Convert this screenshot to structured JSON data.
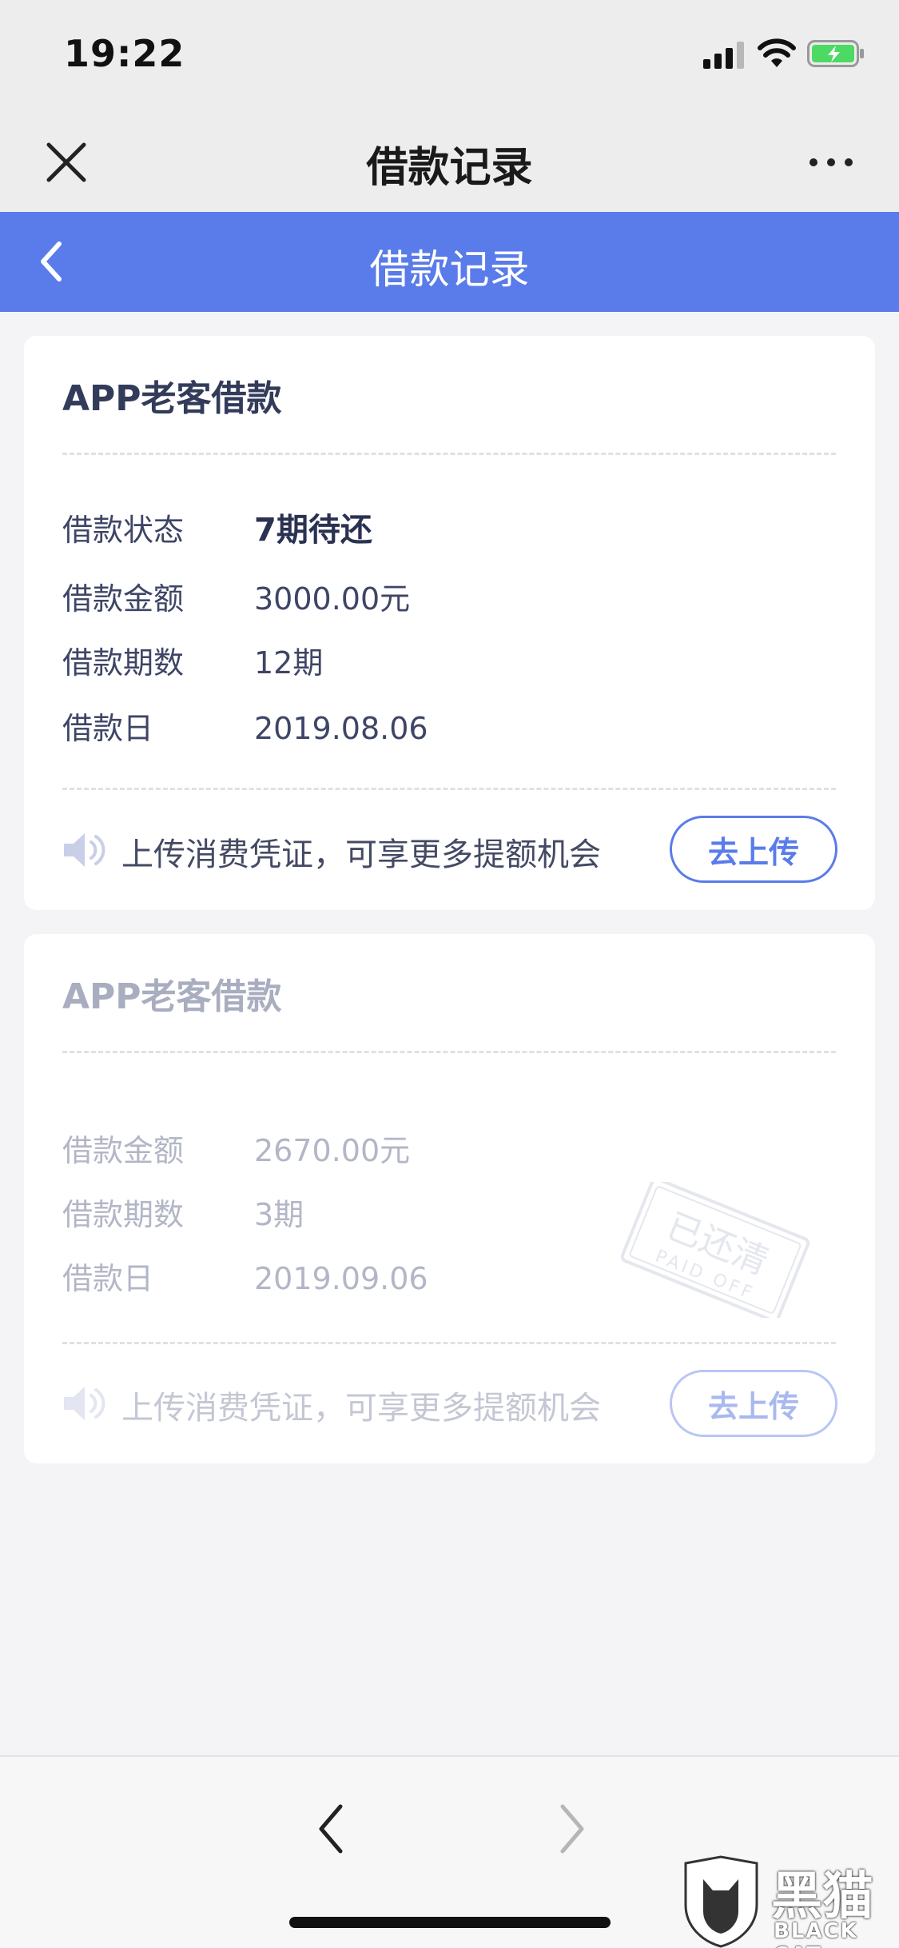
{
  "status": {
    "time": "19:22"
  },
  "webview": {
    "title": "借款记录"
  },
  "app": {
    "title": "借款记录"
  },
  "records": [
    {
      "title": "APP老客借款",
      "rows": [
        {
          "label": "借款状态",
          "value": "7期待还"
        },
        {
          "label": "借款金额",
          "value": "3000.00元"
        },
        {
          "label": "借款期数",
          "value": "12期"
        },
        {
          "label": "借款日",
          "value": "2019.08.06"
        }
      ],
      "notice": "上传消费凭证，可享更多提额机会",
      "button": "去上传"
    },
    {
      "title": "APP老客借款",
      "rows": [
        {
          "label": "借款金额",
          "value": "2670.00元"
        },
        {
          "label": "借款期数",
          "value": "3期"
        },
        {
          "label": "借款日",
          "value": "2019.09.06"
        }
      ],
      "stamp": {
        "text": "已还清",
        "sub": "PAID OFF"
      },
      "notice": "上传消费凭证，可享更多提额机会",
      "button": "去上传"
    }
  ],
  "watermark": {
    "big": "黑猫",
    "small": "BLACK CAT"
  },
  "colors": {
    "accent": "#5a7bea",
    "battery": "#4cd964"
  },
  "icons": [
    "close-icon",
    "more-icon",
    "back-icon",
    "speaker-icon",
    "chevron-left-icon",
    "chevron-right-icon"
  ]
}
